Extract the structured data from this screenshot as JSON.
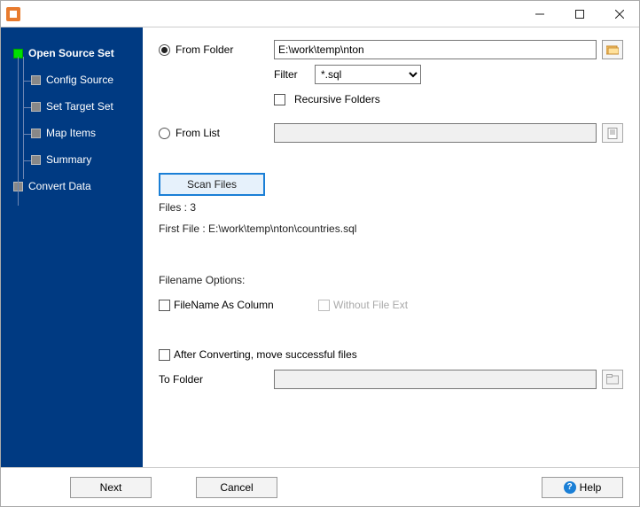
{
  "sidebar": {
    "items": [
      {
        "label": "Open Source Set",
        "active": true,
        "level": 1
      },
      {
        "label": "Config Source",
        "active": false,
        "level": 2
      },
      {
        "label": "Set Target Set",
        "active": false,
        "level": 2
      },
      {
        "label": "Map Items",
        "active": false,
        "level": 2
      },
      {
        "label": "Summary",
        "active": false,
        "level": 2
      },
      {
        "label": "Convert Data",
        "active": false,
        "level": 1
      }
    ]
  },
  "source": {
    "from_folder_label": "From Folder",
    "folder_path": "E:\\work\\temp\\nton",
    "filter_label": "Filter",
    "filter_value": "*.sql",
    "recursive_label": "Recursive Folders",
    "from_list_label": "From List",
    "list_path": "",
    "scan_btn": "Scan Files",
    "files_count": "Files : 3",
    "first_file": "First File : E:\\work\\temp\\nton\\countries.sql"
  },
  "filename_opts": {
    "heading": "Filename Options:",
    "as_column_label": "FileName As Column",
    "without_ext_label": "Without File Ext"
  },
  "after": {
    "move_label": "After Converting, move successful files",
    "to_folder_label": "To Folder",
    "to_folder_path": ""
  },
  "footer": {
    "next": "Next",
    "cancel": "Cancel",
    "help": "Help"
  }
}
